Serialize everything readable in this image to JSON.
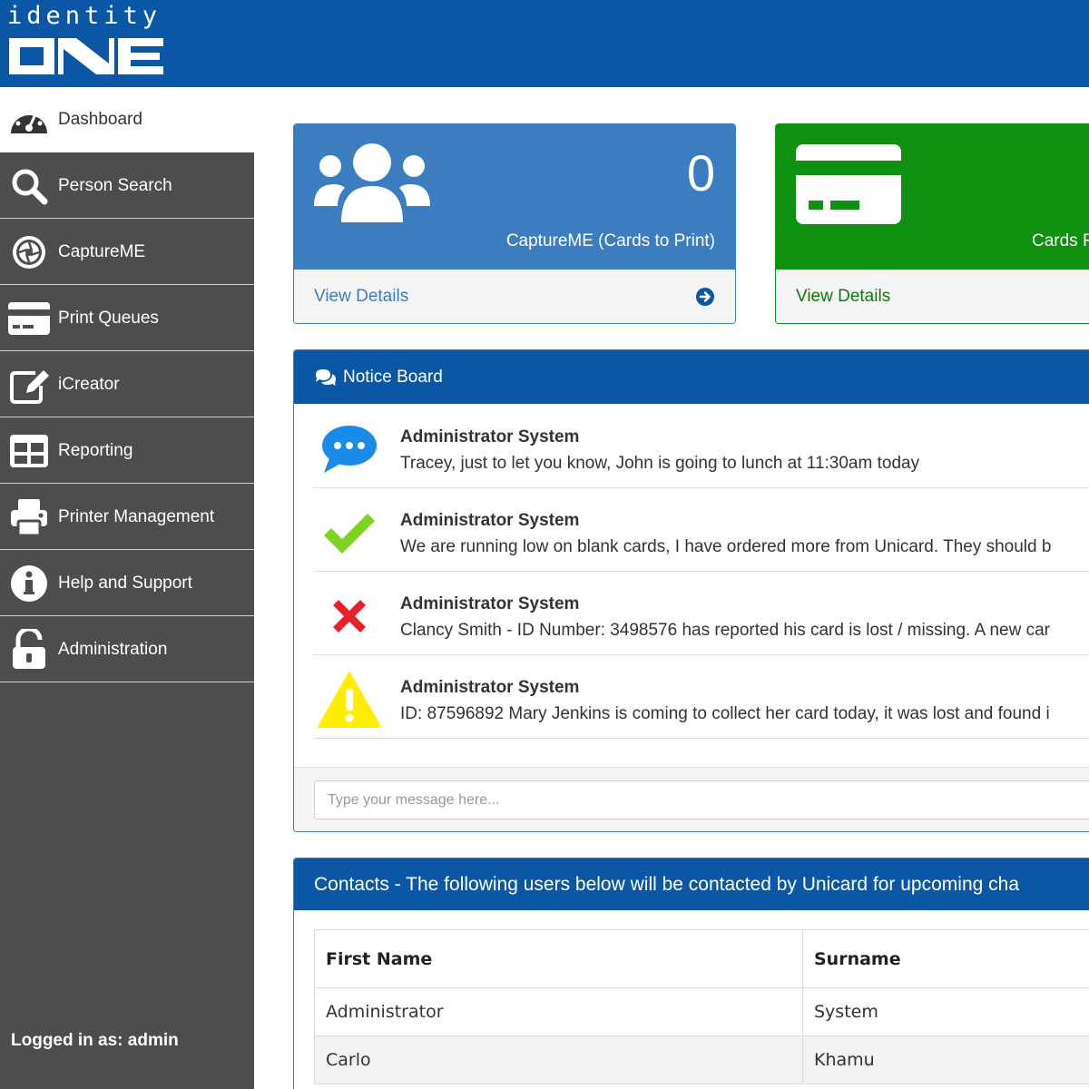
{
  "header": {
    "logo_top": "identity",
    "logo_bottom": "ONE"
  },
  "sidebar": {
    "items": [
      {
        "label": "Dashboard",
        "icon": "dashboard-gauge-icon"
      },
      {
        "label": "Person Search",
        "icon": "search-icon"
      },
      {
        "label": "CaptureME",
        "icon": "camera-aperture-icon"
      },
      {
        "label": "Print Queues",
        "icon": "credit-card-icon"
      },
      {
        "label": "iCreator",
        "icon": "edit-icon"
      },
      {
        "label": "Reporting",
        "icon": "table-icon"
      },
      {
        "label": "Printer Management",
        "icon": "printer-icon"
      },
      {
        "label": "Help and Support",
        "icon": "info-icon"
      },
      {
        "label": "Administration",
        "icon": "unlock-icon"
      }
    ],
    "logged_in": "Logged in as: admin"
  },
  "cards": [
    {
      "count": "0",
      "title": "CaptureME (Cards to Print)",
      "link": "View Details",
      "icon": "users-icon",
      "color": "#3c7dbf"
    },
    {
      "title": "Cards F",
      "link": "View Details",
      "icon": "credit-card-icon",
      "color": "#0e9010"
    }
  ],
  "notice_board": {
    "title": "Notice Board",
    "items": [
      {
        "author": "Administrator System",
        "text": "Tracey, just to let you know, John is going to lunch at 11:30am today",
        "icon": "chat-bubble-icon"
      },
      {
        "author": "Administrator System",
        "text": "We are running low on blank cards, I have ordered more from Unicard. They should b",
        "icon": "check-icon"
      },
      {
        "author": "Administrator System",
        "text": "Clancy Smith - ID Number: 3498576 has reported his card is lost / missing. A new car",
        "icon": "cross-icon"
      },
      {
        "author": "Administrator System",
        "text": "ID: 87596892 Mary Jenkins is coming to collect her card today, it was lost and found i",
        "icon": "warning-icon"
      }
    ],
    "input_placeholder": "Type your message here..."
  },
  "contacts": {
    "title": "Contacts - The following users below will be contacted by Unicard for upcoming cha",
    "columns": [
      "First Name",
      "Surname"
    ],
    "rows": [
      [
        "Administrator",
        "System"
      ],
      [
        "Carlo",
        "Khamu"
      ]
    ]
  },
  "colors": {
    "brand_blue": "#0b57a6",
    "card_blue": "#3c7dbf",
    "card_green": "#0e9010",
    "sidebar_bg": "#4d4d4d"
  }
}
